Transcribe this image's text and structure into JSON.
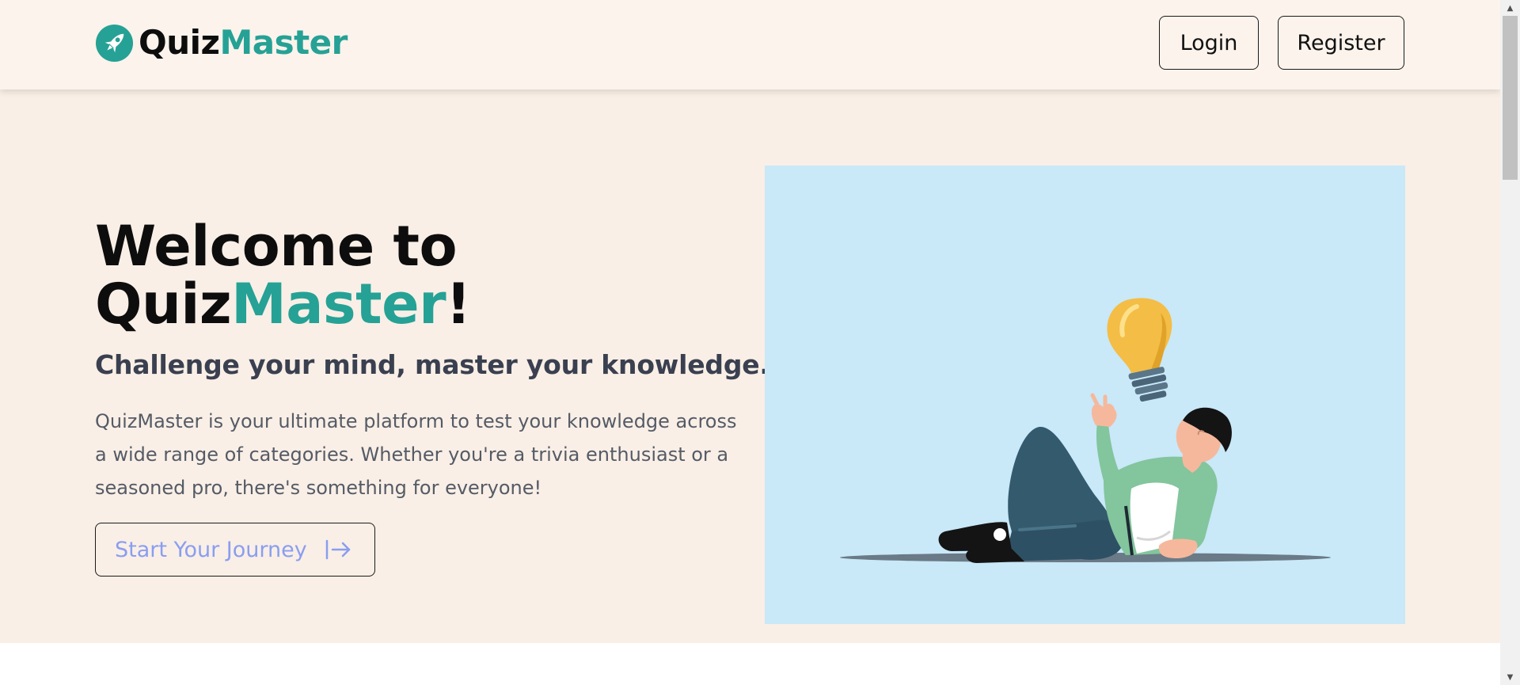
{
  "header": {
    "brand_part1": "Quiz",
    "brand_part2": "Master",
    "logo_icon": "rocket-icon",
    "login_label": "Login",
    "register_label": "Register"
  },
  "hero": {
    "title_line1": "Welcome to",
    "title_brand_part1": "Quiz",
    "title_brand_part2": "Master",
    "title_suffix": "!",
    "subtitle": "Challenge your mind, master your knowledge.",
    "description": "QuizMaster is your ultimate platform to test your knowledge across a wide range of categories. Whether you're a trivia enthusiast or a seasoned pro, there's something for everyone!",
    "cta_label": "Start Your Journey",
    "cta_icon": "arrow-right-to-bar-icon",
    "illustration": "man-reclining-with-lightbulb-illustration"
  },
  "colors": {
    "accent": "#26a195",
    "header_bg": "#fbf3ec",
    "hero_bg": "#f9efe6",
    "illustration_bg": "#c9e8f8",
    "cta_text": "#8a9ef0"
  }
}
